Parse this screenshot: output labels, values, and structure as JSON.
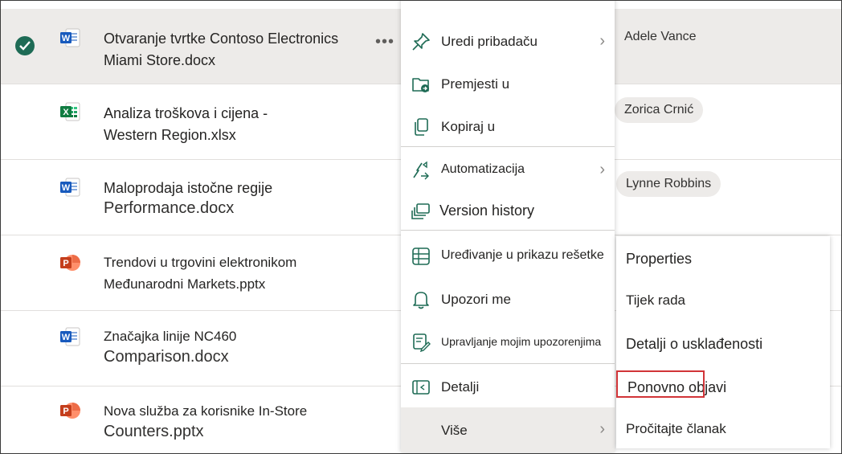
{
  "files": [
    {
      "name_line1": "Otvaranje tvrtke Contoso Electronics",
      "name_line2": "Miami Store.docx",
      "type": "word",
      "modified_by": "Adele Vance",
      "selected": true
    },
    {
      "name_line1": "Analiza troškova i cijena -",
      "name_line2": "Western Region.xlsx",
      "type": "excel",
      "modified_by": "Zorica Crnić",
      "selected": false
    },
    {
      "name_line1": "Maloprodaja istočne regije",
      "name_line2": "Performance.docx",
      "type": "word",
      "modified_by": "Lynne Robbins",
      "selected": false
    },
    {
      "name_line1": "Trendovi u trgovini elektronikom",
      "name_line2": "Međunarodni Markets.pptx",
      "type": "powerpoint",
      "modified_by": "",
      "selected": false
    },
    {
      "name_line1": "Značajka linije NC460",
      "name_line2": "Comparison.docx",
      "type": "word",
      "modified_by": "",
      "selected": false
    },
    {
      "name_line1": "Nova služba za korisnike In-Store",
      "name_line2": "Counters.pptx",
      "type": "powerpoint",
      "modified_by": "",
      "selected": false
    }
  ],
  "row_more_label": "•••",
  "context_menu": {
    "items": [
      {
        "label": "Uredi pribadaču",
        "icon": "pin-icon",
        "has_submenu": true
      },
      {
        "label": "Premjesti u",
        "icon": "move-folder-icon",
        "has_submenu": false
      },
      {
        "label": "Kopiraj u",
        "icon": "copy-icon",
        "has_submenu": false
      },
      {
        "label": "Automatizacija",
        "icon": "automate-icon",
        "has_submenu": true
      },
      {
        "label": "Version history",
        "icon": "version-history-icon",
        "has_submenu": false
      },
      {
        "label": "Uređivanje u prikazu rešetke",
        "icon": "grid-icon",
        "has_submenu": false
      },
      {
        "label": "Upozori me",
        "icon": "bell-icon",
        "has_submenu": false
      },
      {
        "label": "Upravljanje mojim upozorenjima",
        "icon": "manage-alerts-icon",
        "has_submenu": false
      },
      {
        "label": "Detalji",
        "icon": "details-pane-icon",
        "has_submenu": false
      },
      {
        "label": "Više",
        "icon": "",
        "has_submenu": true
      }
    ]
  },
  "submenu": {
    "items": [
      {
        "label": "Properties"
      },
      {
        "label": "Tijek rada"
      },
      {
        "label": "Detalji o usklađenosti"
      },
      {
        "label": "Ponovno objavi",
        "highlighted": true
      },
      {
        "label": "Pročitajte članak"
      }
    ]
  },
  "colors": {
    "accent_green": "#1e6b55",
    "highlight_red": "#d13438",
    "word_blue": "#185abd",
    "excel_green": "#107c41",
    "powerpoint_red": "#c43e1c"
  }
}
